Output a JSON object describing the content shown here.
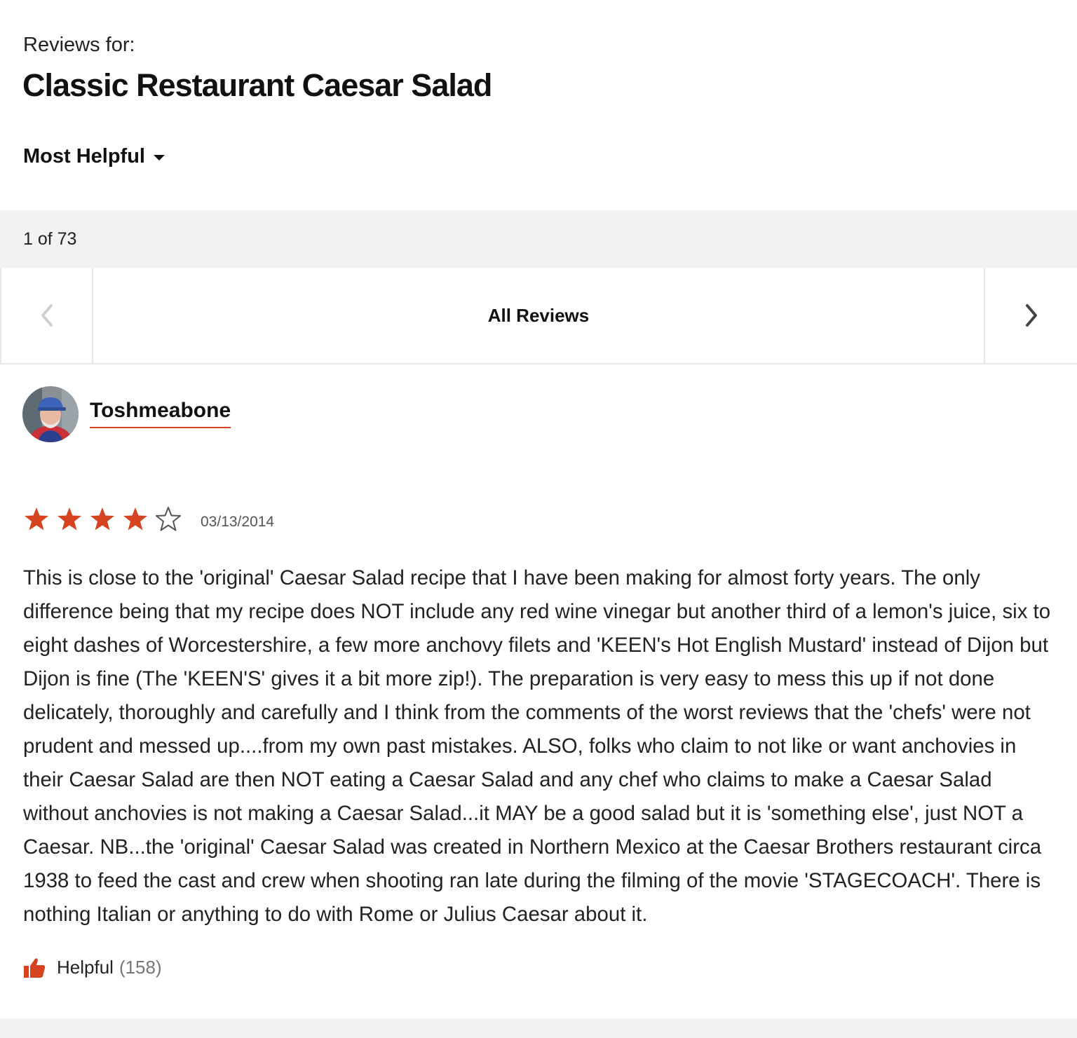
{
  "header": {
    "reviews_for_label": "Reviews for:",
    "recipe_title": "Classic Restaurant Caesar Salad"
  },
  "sort": {
    "label": "Most Helpful",
    "icon": "chevron-down-icon"
  },
  "pagination": {
    "counter": "1 of 73",
    "current_view": "All Reviews"
  },
  "review": {
    "reviewer_name": "Toshmeabone",
    "rating": 4,
    "rating_max": 5,
    "date": "03/13/2014",
    "body": "This is close to the 'original' Caesar Salad recipe that I have been making for almost forty years. The only difference being that my recipe does NOT include any red wine vinegar but another third of a lemon's juice, six to eight dashes of Worcestershire, a few more anchovy filets and 'KEEN's Hot English Mustard' instead of Dijon but Dijon is fine (The 'KEEN'S' gives it a bit more zip!). The preparation is very easy to mess this up if not done delicately, thoroughly and carefully and I think from the comments of the worst reviews that the 'chefs' were not prudent and messed up....from my own past mistakes. ALSO, folks who claim to not like or want anchovies in their Caesar Salad are then NOT eating a Caesar Salad and any chef who claims to make a Caesar Salad without anchovies is not making a Caesar Salad...it MAY be a good salad but it is 'something else', just NOT a Caesar. NB...the 'original' Caesar Salad was created in Northern Mexico at the Caesar Brothers restaurant circa 1938 to feed the cast and crew when shooting ran late during the filming of the movie 'STAGECOACH'. There is nothing Italian or anything to do with Rome or Julius Caesar about it.",
    "helpful_label": "Helpful",
    "helpful_count": "(158)"
  },
  "colors": {
    "accent": "#d54321",
    "star_filled": "#d54321",
    "star_empty_outline": "#555555",
    "counter_bar_bg": "#f2f2f2"
  }
}
